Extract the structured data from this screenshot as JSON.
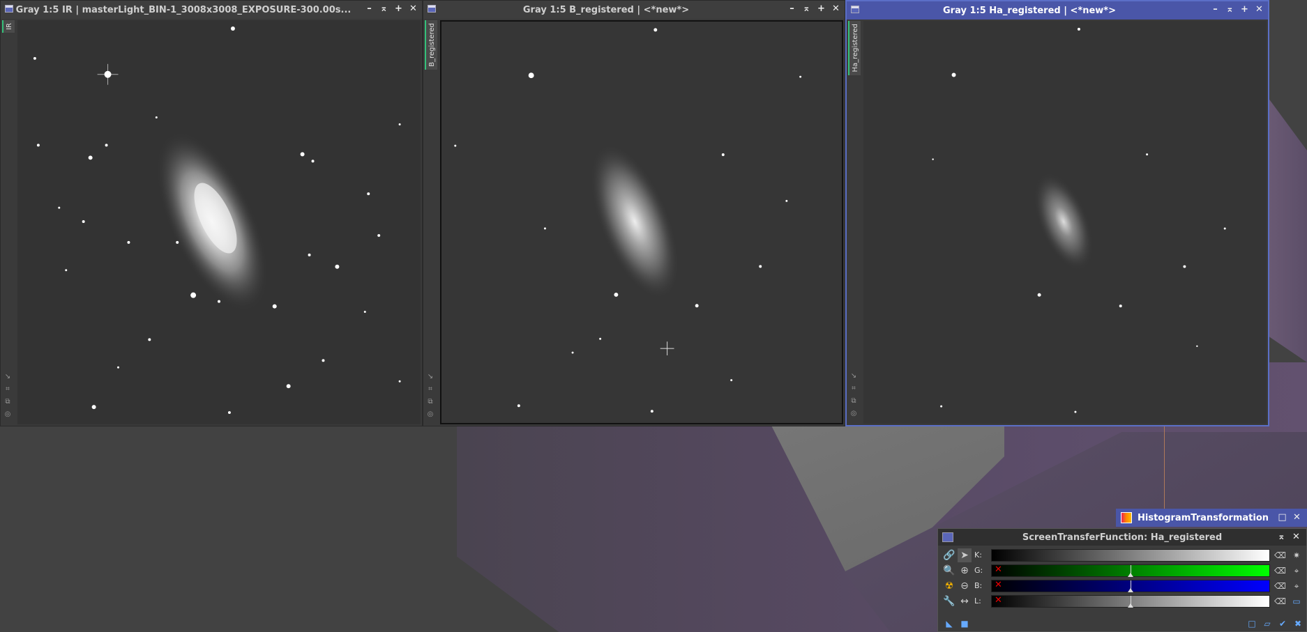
{
  "windows": [
    {
      "id": "ir",
      "title": "Gray 1:5 IR | masterLight_BIN-1_3008x3008_EXPOSURE-300.00s...",
      "tab": "IR",
      "active": false
    },
    {
      "id": "b",
      "title": "Gray 1:5 B_registered | <*new*>",
      "tab": "B_registered",
      "active": false
    },
    {
      "id": "ha",
      "title": "Gray 1:5 Ha_registered | <*new*>",
      "tab": "Ha_registered",
      "active": true
    }
  ],
  "window_controls": {
    "minimize": "–",
    "shade": "⌅",
    "maximize": "+",
    "close": "✕"
  },
  "histogram": {
    "title": "HistogramTransformation",
    "controls": {
      "maximize": "□",
      "close": "✕"
    }
  },
  "stf": {
    "title": "ScreenTransferFunction: Ha_registered",
    "channels": [
      {
        "label": "K:",
        "gradient_end": "#ffffff",
        "has_x": false,
        "midtone": null
      },
      {
        "label": "G:",
        "gradient_end": "#00ff00",
        "has_x": true,
        "midtone": 0.5
      },
      {
        "label": "B:",
        "gradient_end": "#0000ff",
        "has_x": true,
        "midtone": 0.5
      },
      {
        "label": "L:",
        "gradient_end": "#ffffff",
        "has_x": true,
        "midtone": 0.5
      }
    ],
    "x_mark": "✕",
    "controls": {
      "shade": "⌅",
      "close": "✕"
    }
  },
  "colors": {
    "active_title": "#4a56a8",
    "active_border": "#5b6fc7",
    "tab_accent": "#35c07a"
  }
}
